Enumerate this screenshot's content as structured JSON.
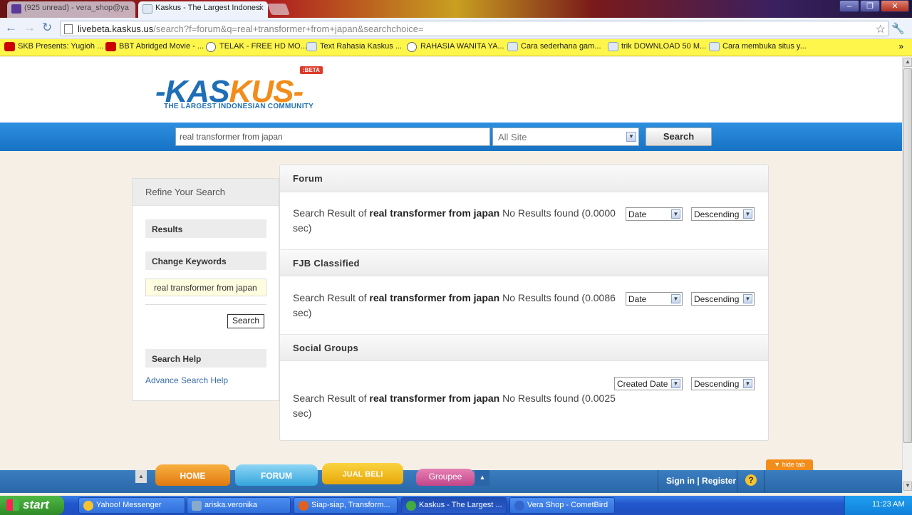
{
  "browser": {
    "tabs": [
      {
        "title": "(925 unread) - vera_shop@ya"
      },
      {
        "title": "Kaskus - The Largest Indonesi"
      }
    ],
    "url_host": "livebeta.kaskus.us",
    "url_path": "/search?f=forum&q=real+transformer+from+japan&searchchoice=",
    "bookmarks": [
      {
        "label": "SKB Presents: Yugioh ..."
      },
      {
        "label": "BBT Abridged Movie - ..."
      },
      {
        "label": "TELAK - FREE HD MO..."
      },
      {
        "label": "Text Rahasia Kaskus ..."
      },
      {
        "label": "RAHASIA WANITA YA..."
      },
      {
        "label": "Cara sederhana gam..."
      },
      {
        "label": "trik DOWNLOAD 50 M..."
      },
      {
        "label": "Cara membuka situs y..."
      }
    ]
  },
  "site": {
    "logo_word_a": "-KAS",
    "logo_word_b": "KUS-",
    "beta": ":BETA",
    "tagline": "THE LARGEST INDONESIAN COMMUNITY",
    "search_value": "real transformer from japan",
    "search_scope": "All Site",
    "search_button": "Search"
  },
  "sidebar": {
    "title": "Refine Your Search",
    "results_label": "Results",
    "change_keywords_label": "Change Keywords",
    "keyword_value": "real transformer from japan",
    "search_button": "Search",
    "help_label": "Search Help",
    "help_link": "Advance Search Help"
  },
  "sections": [
    {
      "title": "Forum",
      "prefix": "Search Result of ",
      "query": "real transformer from japan",
      "suffix": " No Results found (0.0000 sec)",
      "sort_field": "Date",
      "sort_order": "Descending"
    },
    {
      "title": "FJB Classified",
      "prefix": "Search Result of ",
      "query": "real transformer from japan",
      "suffix": " No Results found (0.0086 sec)",
      "sort_field": "Date",
      "sort_order": "Descending"
    },
    {
      "title": "Social Groups",
      "prefix": "Search Result of ",
      "query": "real transformer from japan",
      "suffix": " No Results found (0.0025 sec)",
      "sort_field": "Created Date",
      "sort_order": "Descending"
    }
  ],
  "bottom_nav": {
    "home": "HOME",
    "forum": "FORUM",
    "jual_beli": "JUAL BELI",
    "groupee": "Groupee",
    "sign_in": "Sign in",
    "separator": " | ",
    "register": "Register",
    "help": "?",
    "hide_tab": "▼ hide tab"
  },
  "taskbar": {
    "start": "start",
    "items": [
      {
        "label": "Yahoo! Messenger"
      },
      {
        "label": "ariska.veronika"
      },
      {
        "label": "Siap-siap, Transform..."
      },
      {
        "label": "Kaskus - The Largest ..."
      },
      {
        "label": "Vera Shop - CometBird"
      }
    ],
    "clock": "11:23 AM"
  },
  "colors": {
    "kaskus_blue": "#1e6fb5",
    "kaskus_orange": "#f28c1a",
    "bookmark_bar": "#fef64a",
    "search_band": "#1772c4"
  }
}
